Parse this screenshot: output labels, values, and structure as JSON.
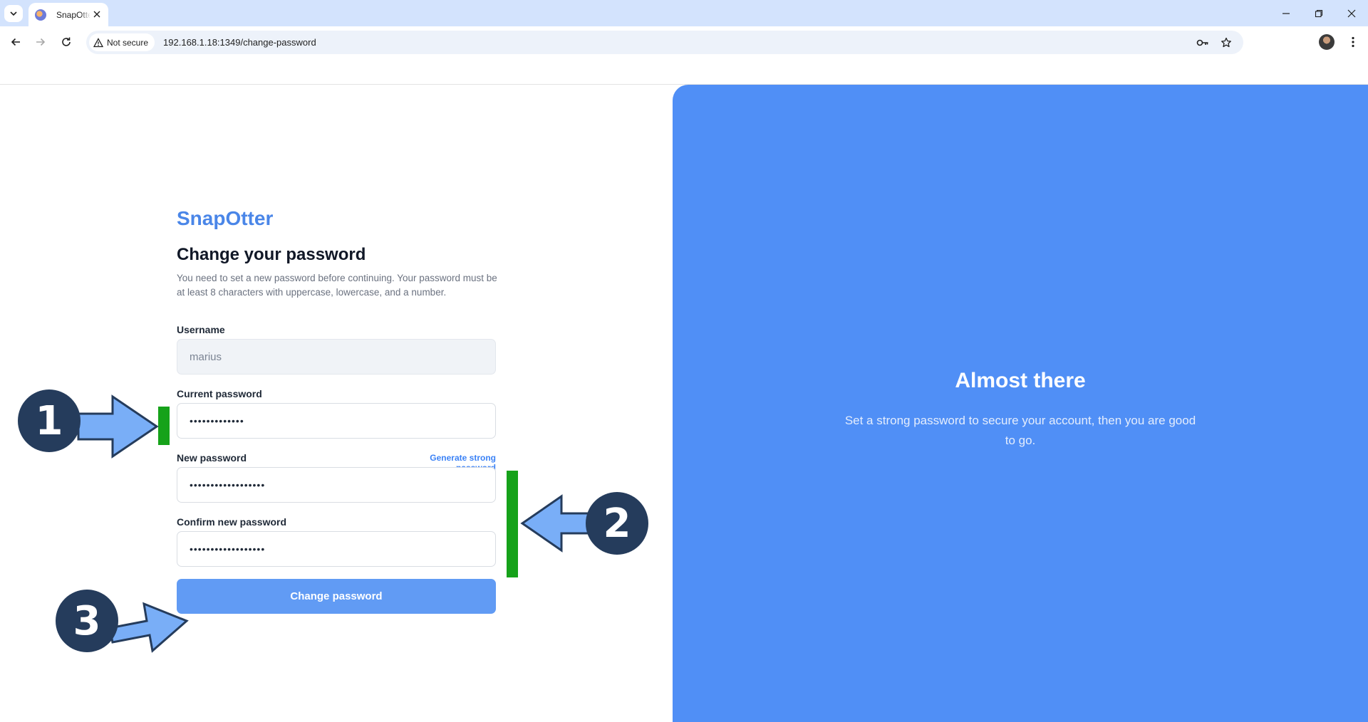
{
  "browser": {
    "tab": {
      "title": "SnapOtter",
      "favicon": "snapotter-favicon-icon"
    },
    "security_label": "Not secure",
    "url": "192.168.1.18:1349/change-password"
  },
  "form": {
    "brand": "SnapOtter",
    "heading": "Change your password",
    "description": "You need to set a new password before continuing. Your password must be at least 8 characters with uppercase, lowercase, and a number.",
    "username": {
      "label": "Username",
      "value": "marius"
    },
    "current_password": {
      "label": "Current password",
      "value": "•••••••••••••"
    },
    "new_password": {
      "label": "New password",
      "value": "••••••••••••••••••",
      "generate_link": "Generate strong password"
    },
    "confirm_password": {
      "label": "Confirm new password",
      "value": "••••••••••••••••••"
    },
    "submit_label": "Change password"
  },
  "panel": {
    "title": "Almost there",
    "text": "Set a strong password to secure your account, then you are good to go.",
    "color": "#508ff6"
  },
  "annotations": {
    "badges": [
      "1",
      "2",
      "3"
    ],
    "arrow_color": "#79aef7",
    "marker_color": "#16a21a",
    "badge_color": "#253c5c"
  }
}
